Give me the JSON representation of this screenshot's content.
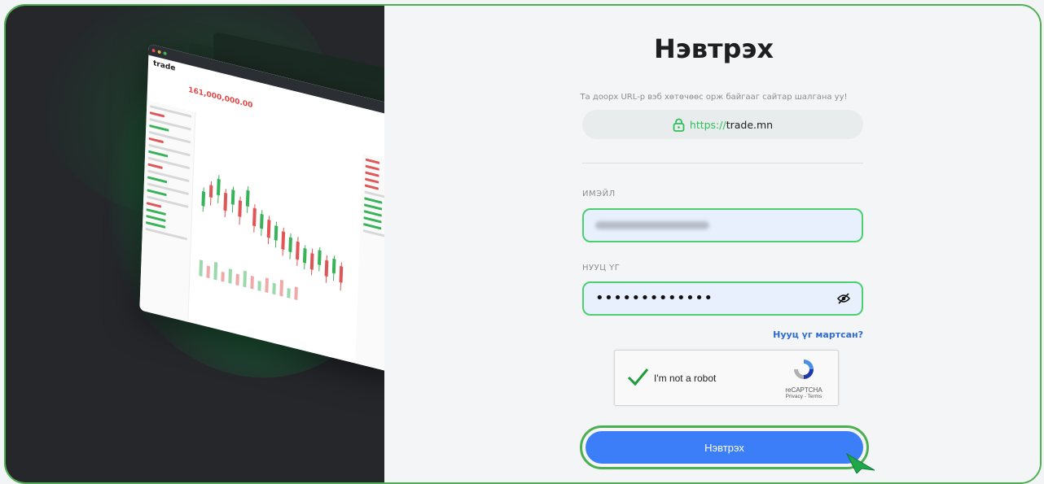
{
  "page": {
    "title": "Нэвтрэх",
    "hint": "Та доорх URL-р вэб хөтөчөөс орж байгааг сайтар шалгана уу!",
    "url": {
      "protocol": "https://",
      "host": "trade.mn",
      "icon": "lock-icon"
    }
  },
  "form": {
    "email_label": "ИМЭЙЛ",
    "password_label": "НУУЦ ҮГ",
    "password_value": "•••••••••••••",
    "eye_icon": "eye-icon",
    "forgot_label": "Нууц үг мартсан?",
    "submit_label": "Нэвтрэх"
  },
  "captcha": {
    "label": "I'm not a robot",
    "brand": "reCAPTCHA",
    "links": "Privacy - Terms",
    "checked": true
  },
  "colors": {
    "accent_green": "#4caf50",
    "button_blue": "#3b7ef7",
    "link_blue": "#2e6bd6",
    "dark_panel": "#25272b"
  },
  "preview": {
    "logo": "trade",
    "price": "161,000,000.00"
  }
}
